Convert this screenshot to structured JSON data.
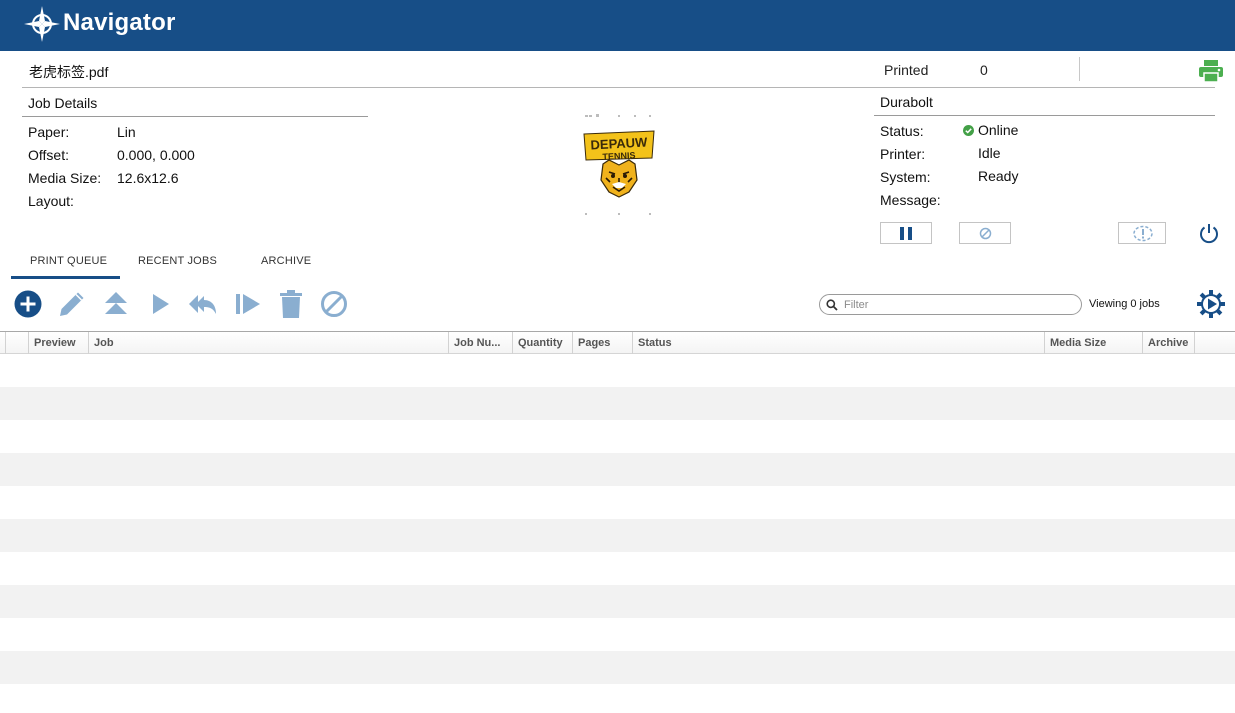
{
  "app": {
    "title": "Navigator",
    "brand_color": "#174e87"
  },
  "file": {
    "name": "老虎标签.pdf",
    "printed_label": "Printed",
    "printed_value": "0"
  },
  "job_details": {
    "title": "Job Details",
    "paper_label": "Paper:",
    "paper_value": "Lin",
    "offset_label": "Offset:",
    "offset_value": "0.000, 0.000",
    "media_label": "Media Size:",
    "media_value": "12.6x12.6",
    "layout_label": "Layout:",
    "layout_value": ""
  },
  "preview": {
    "line1": "DEPAUW",
    "line2": "TENNIS"
  },
  "printer": {
    "name": "Durabolt",
    "status_label": "Status:",
    "status_value": "Online",
    "printer_label": "Printer:",
    "printer_value": "Idle",
    "system_label": "System:",
    "system_value": "Ready",
    "message_label": "Message:",
    "message_value": "",
    "online_color": "#43a047"
  },
  "tabs": [
    {
      "label": "PRINT QUEUE",
      "active": true
    },
    {
      "label": "RECENT JOBS",
      "active": false
    },
    {
      "label": "ARCHIVE",
      "active": false
    }
  ],
  "toolbar": {
    "icons": [
      "add-icon",
      "edit-icon",
      "move-top-icon",
      "play-icon",
      "reply-all-icon",
      "step-forward-icon",
      "trash-icon",
      "cancel-icon"
    ],
    "icon_color": "#8aaed0",
    "filter_placeholder": "Filter",
    "viewing": "Viewing 0 jobs"
  },
  "table": {
    "columns": [
      "",
      "Preview",
      "Job",
      "Job Nu...",
      "Quantity",
      "Pages",
      "Status",
      "Media Size",
      "Archive",
      ""
    ],
    "rows": []
  }
}
